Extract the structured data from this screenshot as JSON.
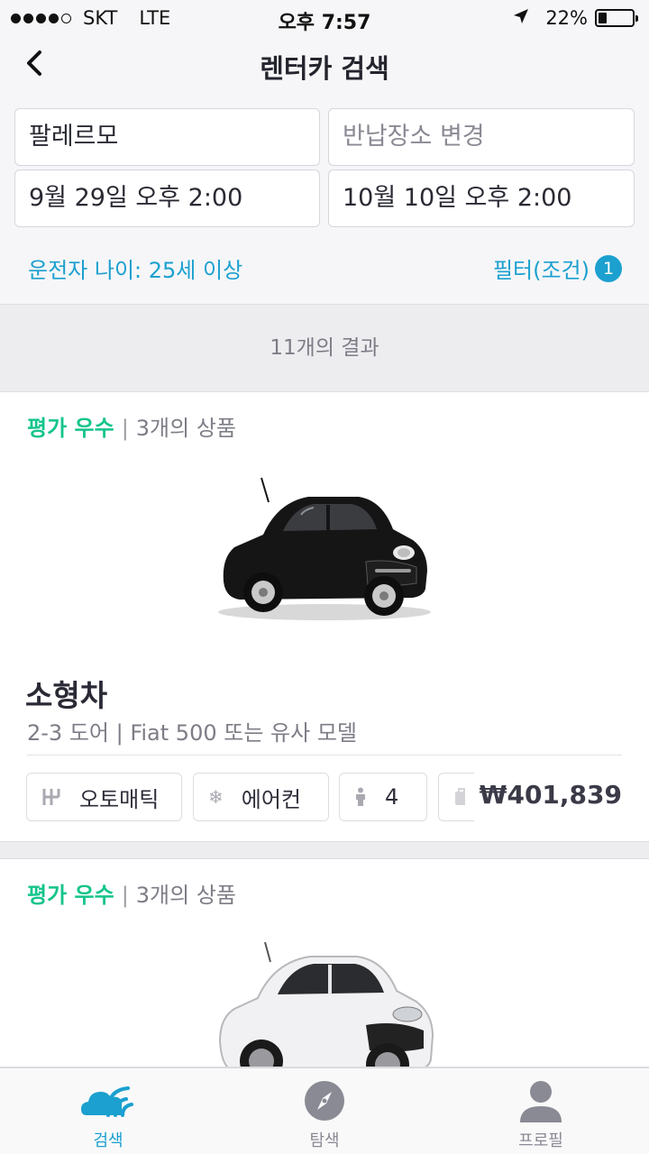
{
  "status_bar": {
    "carrier": "SKT",
    "network": "LTE",
    "time": "오후 7:57",
    "battery": "22%",
    "battery_level": 0.22
  },
  "nav": {
    "title": "렌터카 검색"
  },
  "search": {
    "pickup_location": "팔레르모",
    "return_location_placeholder": "반납장소 변경",
    "pickup_datetime": "9월 29일 오후 2:00",
    "return_datetime": "10월 10일 오후 2:00",
    "driver_age": "운전자 나이: 25세 이상",
    "filter_label": "필터(조건)",
    "filter_count": "1"
  },
  "results": {
    "count_label": "11개의 결과"
  },
  "cards": [
    {
      "rating": "평가 우수",
      "offers": "3개의 상품",
      "class": "소형차",
      "description": "2-3 도어 | Fiat 500 또는 유사 모델",
      "transmission": "오토매틱",
      "ac": "에어컨",
      "seats": "4",
      "price": "₩401,839",
      "car_color": "black"
    },
    {
      "rating": "평가 우수",
      "offers": "3개의 상품",
      "car_color": "white"
    }
  ],
  "tabs": [
    {
      "label": "검색",
      "icon": "search-cloud-icon",
      "active": true
    },
    {
      "label": "탐색",
      "icon": "compass-icon",
      "active": false
    },
    {
      "label": "프로필",
      "icon": "profile-icon",
      "active": false
    }
  ],
  "colors": {
    "accent": "#1ba0cf",
    "rating": "#15c48c"
  }
}
